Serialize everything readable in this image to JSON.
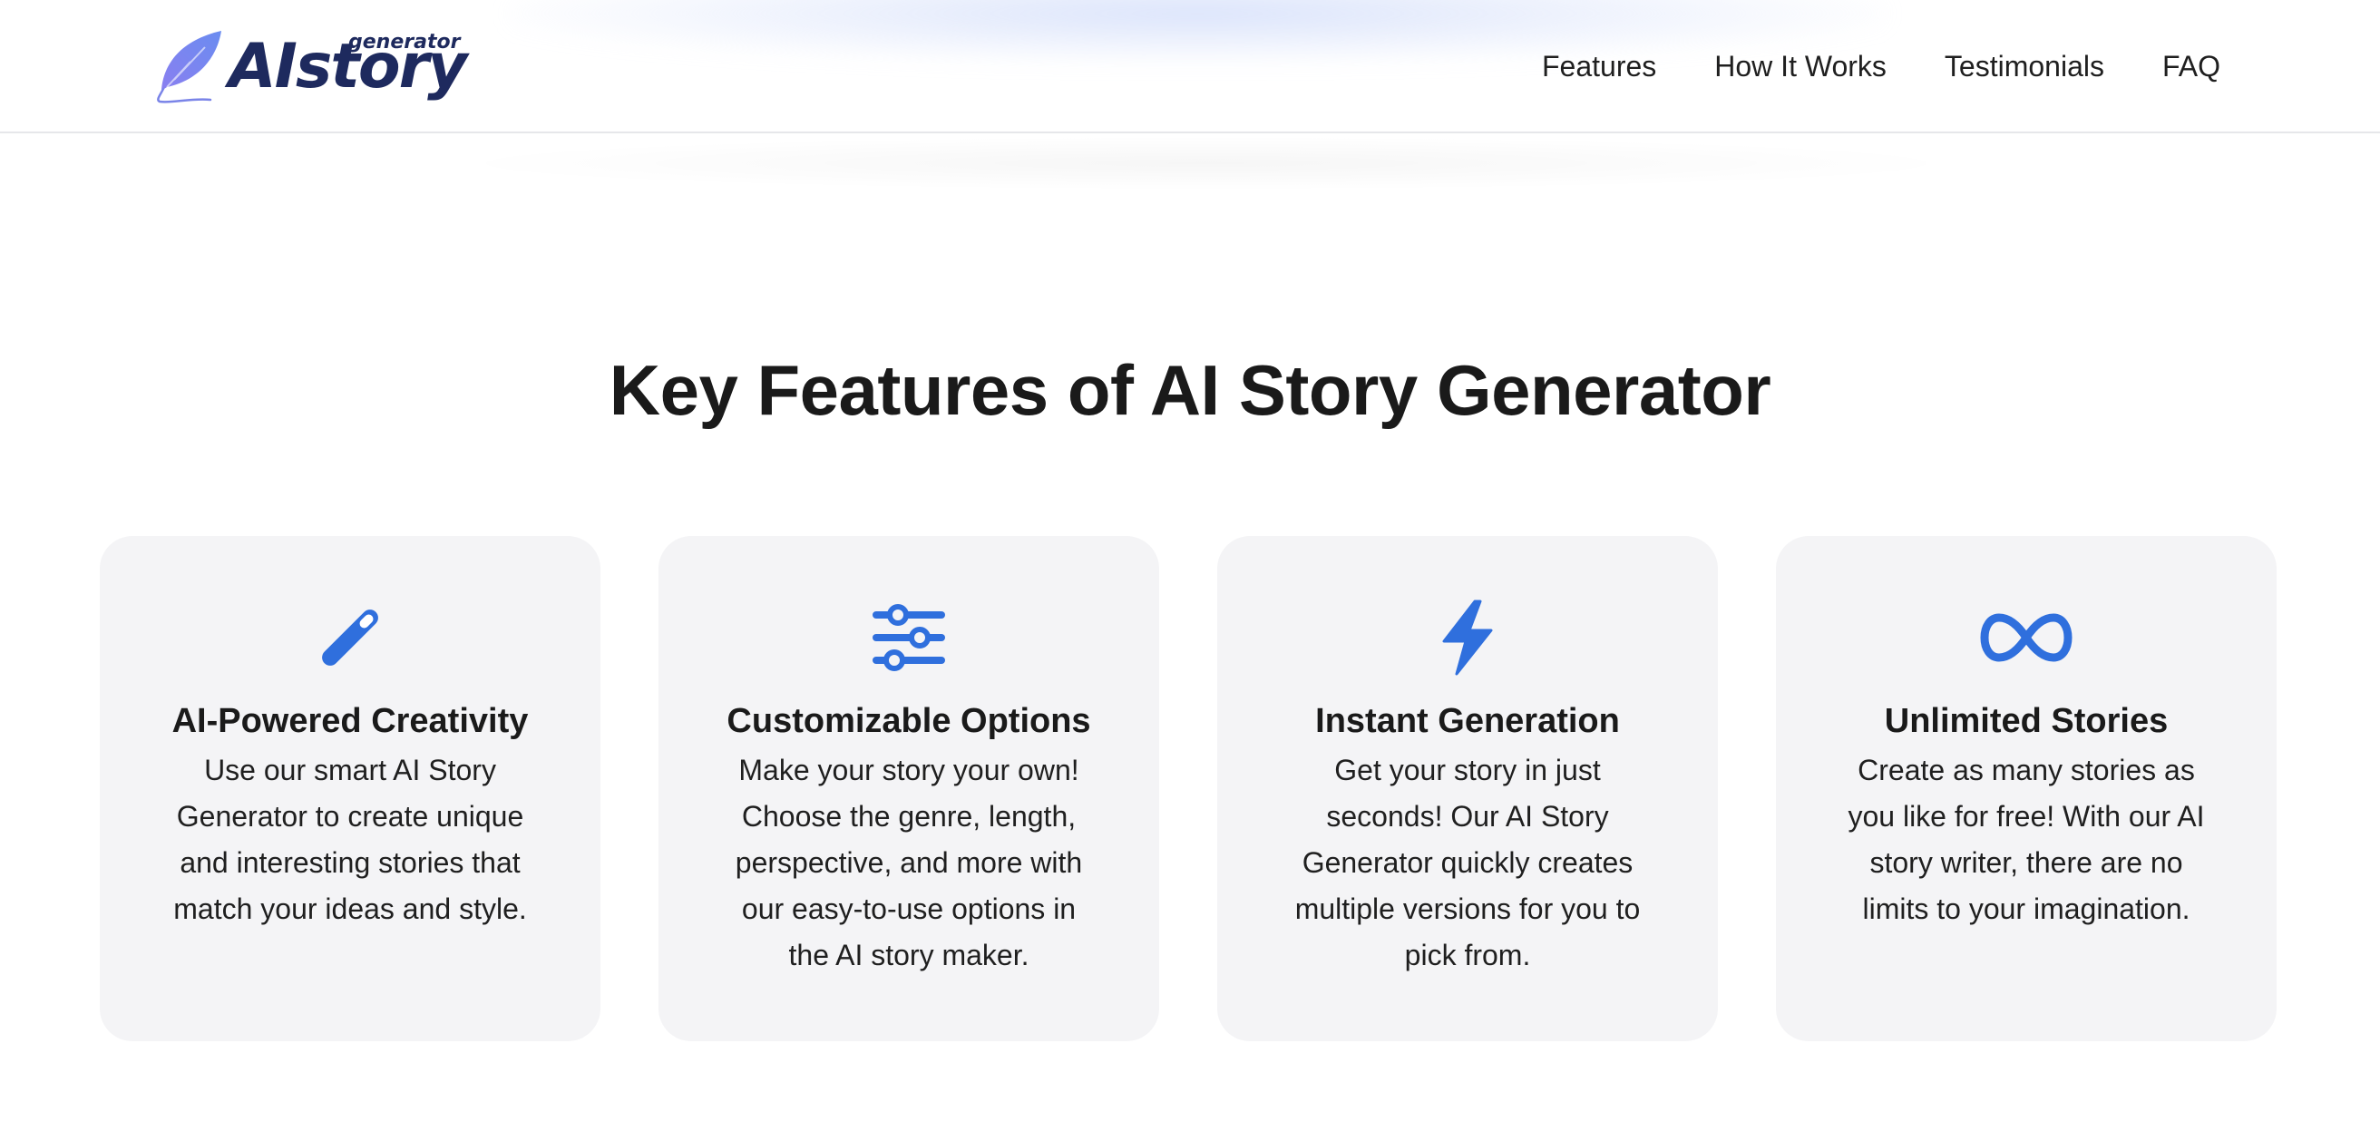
{
  "brand": {
    "logo_text": "AIstory",
    "logo_subtext": "generator",
    "accent_color": "#2f6fdd",
    "logo_color": "#1e2a5e"
  },
  "nav": {
    "items": [
      {
        "label": "Features"
      },
      {
        "label": "How It Works"
      },
      {
        "label": "Testimonials"
      },
      {
        "label": "FAQ"
      }
    ]
  },
  "features": {
    "title": "Key Features of AI Story Generator",
    "cards": [
      {
        "icon": "magic-wand-icon",
        "title": "AI-Powered Creativity",
        "text": "Use our smart AI Story Generator to create unique and interesting stories that match your ideas and style."
      },
      {
        "icon": "sliders-icon",
        "title": "Customizable Options",
        "text": "Make your story your own! Choose the genre, length, perspective, and more with our easy-to-use options in the AI story maker."
      },
      {
        "icon": "lightning-bolt-icon",
        "title": "Instant Generation",
        "text": "Get your story in just seconds! Our AI Story Generator quickly creates multiple versions for you to pick from."
      },
      {
        "icon": "infinity-icon",
        "title": "Unlimited Stories",
        "text": "Create as many stories as you like for free! With our AI story writer, there are no limits to your imagination."
      }
    ]
  }
}
